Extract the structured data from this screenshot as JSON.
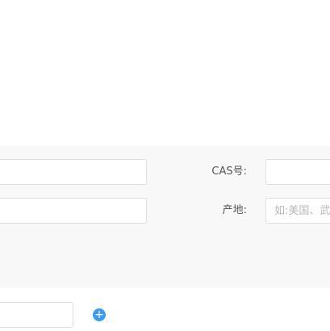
{
  "form": {
    "field_left_1": {
      "value": ""
    },
    "field_left_2": {
      "value": ""
    },
    "cas": {
      "label": "CAS号:",
      "value": ""
    },
    "origin": {
      "label": "产地:",
      "placeholder": "如:美国、武汉"
    }
  },
  "bottom": {
    "input_value": "",
    "add_icon": "plus-circle-icon",
    "add_symbol": "+"
  },
  "colors": {
    "panel_bg": "#f8f8f8",
    "accent": "#3d9bf0"
  }
}
